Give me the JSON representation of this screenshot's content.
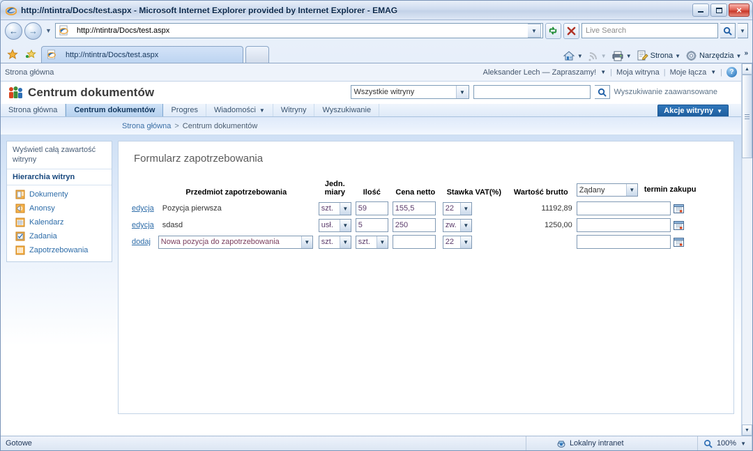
{
  "window": {
    "title": "http://ntintra/Docs/test.aspx - Microsoft Internet Explorer provided by Internet Explorer - EMAG",
    "icon": "ie-logo-icon",
    "minimize_label": "Minimalizuj",
    "restore_label": "Przywróć",
    "close_label": "×"
  },
  "addressbar": {
    "back_glyph": "←",
    "forward_glyph": "→",
    "history_caret": "▼",
    "url": "http://ntintra/Docs/test.aspx",
    "url_dropdown_caret": "▼",
    "refresh_icon": "refresh-icon",
    "stop_icon": "stop-icon",
    "search_placeholder": "Live Search",
    "search_value": "",
    "search_icon": "magnifier-icon",
    "search_caret": "▼"
  },
  "tabbar": {
    "favorites_icon": "favorites-star-icon",
    "add_favorite_icon": "add-favorite-icon",
    "tabs": [
      {
        "label": "http://ntintra/Docs/test.aspx",
        "icon": "ie-page-icon",
        "active": true
      }
    ],
    "new_tab_label": "",
    "commands": [
      {
        "name": "home",
        "icon": "home-icon",
        "label": "",
        "caret": "▼"
      },
      {
        "name": "feeds",
        "icon": "rss-icon",
        "label": "",
        "caret": "▼"
      },
      {
        "name": "print",
        "icon": "printer-icon",
        "label": "",
        "caret": "▼"
      },
      {
        "name": "page",
        "icon": "page-icon",
        "label": "Strona",
        "caret": "▼"
      },
      {
        "name": "tools",
        "icon": "gear-icon",
        "label": "Narzędzia",
        "caret": "▼"
      }
    ],
    "overflow_label": "»"
  },
  "sharepoint": {
    "topbar": {
      "left_link": "Strona główna",
      "welcome": "Aleksander Lech — Zapraszamy!",
      "welcome_caret": "▼",
      "my_site": "Moja witryna",
      "my_links": "Moje łącza",
      "my_links_caret": "▼",
      "help_glyph": "?",
      "sep": "|"
    },
    "site_title": "Centrum dokumentów",
    "site_logo_icon": "sharepoint-people-icon",
    "search": {
      "scope": "Wszystkie witryny",
      "scope_caret": "▼",
      "query": "",
      "search_icon": "magnifier-icon",
      "advanced_label": "Wyszukiwanie zaawansowane"
    },
    "nav_tabs": [
      {
        "label": "Strona główna",
        "active": false,
        "caret": ""
      },
      {
        "label": "Centrum dokumentów",
        "active": true,
        "caret": ""
      },
      {
        "label": "Progres",
        "active": false,
        "caret": ""
      },
      {
        "label": "Wiadomości",
        "active": false,
        "caret": "▼"
      },
      {
        "label": "Witryny",
        "active": false,
        "caret": ""
      },
      {
        "label": "Wyszukiwanie",
        "active": false,
        "caret": ""
      }
    ],
    "site_actions": {
      "label": "Akcje witryny",
      "caret": "▼"
    },
    "breadcrumb": {
      "root": "Strona główna",
      "separator": ">",
      "current": "Centrum dokumentów"
    },
    "leftnav": {
      "view_all": "Wyświetl całą zawartość witryny",
      "heading": "Hierarchia witryn",
      "items": [
        {
          "label": "Dokumenty",
          "icon": "document-library-icon"
        },
        {
          "label": "Anonsy",
          "icon": "announcements-icon"
        },
        {
          "label": "Kalendarz",
          "icon": "calendar-icon"
        },
        {
          "label": "Zadania",
          "icon": "tasks-icon"
        },
        {
          "label": "Zapotrzebowania",
          "icon": "list-icon"
        }
      ]
    }
  },
  "form": {
    "title": "Formularz zapotrzebowania",
    "headers": {
      "item": "Przedmiot zapotrzebowania",
      "uom_line1": "Jedn.",
      "uom_line2": "miary",
      "qty": "Ilość",
      "price": "Cena netto",
      "vat": "Stawka VAT(%)",
      "gross": "Wartość brutto",
      "date_select": "Żądany",
      "date_select_caret": "▼",
      "date_label": "termin zakupu"
    },
    "rows": [
      {
        "action_label": "edycja",
        "name": "Pozycja pierwsza",
        "uom": "szt.",
        "qty": "59",
        "price": "155,5",
        "vat": "22",
        "gross": "11192,89",
        "date": "",
        "calendar_icon": "calendar-picker-icon"
      },
      {
        "action_label": "edycja",
        "name": "sdasd",
        "uom": "usł.",
        "qty": "5",
        "price": "250",
        "vat": "zw.",
        "gross": "1250,00",
        "date": "",
        "calendar_icon": "calendar-picker-icon"
      }
    ],
    "new_row": {
      "action_label": "dodaj",
      "item_select": "Nowa pozycja do zapotrzebowania",
      "item_select_caret": "▼",
      "uom": "szt.",
      "qty_select": "szt.",
      "price": "",
      "vat": "22",
      "gross": "",
      "date": "",
      "calendar_icon": "calendar-picker-icon"
    }
  },
  "statusbar": {
    "status": "Gotowe",
    "zone": "Lokalny intranet",
    "zone_icon": "intranet-zone-icon",
    "zoom": "100%",
    "zoom_icon": "magnifier-icon",
    "zoom_caret": "▼"
  },
  "colors": {
    "accent": "#2f76ba",
    "link": "#2d6ca8",
    "field_text": "#5a3a6a",
    "title_text": "#0c2a4d"
  }
}
